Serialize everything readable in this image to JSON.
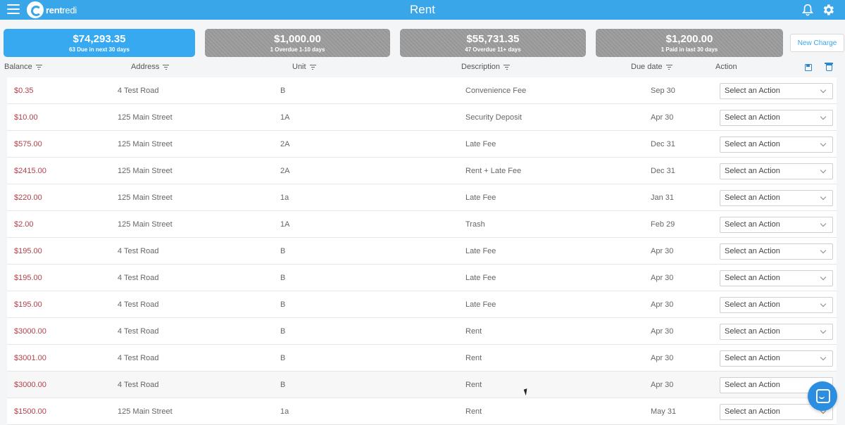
{
  "app": {
    "logo_bold": "rent",
    "logo_light": "redi",
    "title": "Rent"
  },
  "colors": {
    "accent": "#3aa6ea",
    "balance": "#b0414b",
    "card_inactive": "#9b9b9b"
  },
  "icons": {
    "menu": "hamburger-icon",
    "bell": "bell-icon",
    "settings": "gear-icon"
  },
  "cards": [
    {
      "amount": "$74,293.35",
      "label": "63 Due in next 30 days",
      "active": true
    },
    {
      "amount": "$1,000.00",
      "label": "1 Overdue 1-10 days",
      "active": false
    },
    {
      "amount": "$55,731.35",
      "label": "47 Overdue 11+ days",
      "active": false
    },
    {
      "amount": "$1,200.00",
      "label": "1 Paid in last 30 days",
      "active": false
    }
  ],
  "new_charge_label": "New Charge",
  "columns": {
    "balance": "Balance",
    "address": "Address",
    "unit": "Unit",
    "description": "Description",
    "due_date": "Due date",
    "action": "Action"
  },
  "rows": [
    {
      "balance": "$0.35",
      "address": "4 Test Road",
      "unit": "B",
      "description": "Convenience Fee",
      "due": "Sep 30",
      "action": "Select an Action"
    },
    {
      "balance": "$10.00",
      "address": "125 Main Street",
      "unit": "1A",
      "description": "Security Deposit",
      "due": "Apr 30",
      "action": "Select an Action"
    },
    {
      "balance": "$575.00",
      "address": "125 Main Street",
      "unit": "2A",
      "description": "Late Fee",
      "due": "Dec 31",
      "action": "Select an Action"
    },
    {
      "balance": "$2415.00",
      "address": "125 Main Street",
      "unit": "2A",
      "description": "Rent + Late Fee",
      "due": "Dec 31",
      "action": "Select an Action"
    },
    {
      "balance": "$220.00",
      "address": "125 Main Street",
      "unit": "1a",
      "description": "Late Fee",
      "due": "Jan 31",
      "action": "Select an Action"
    },
    {
      "balance": "$2.00",
      "address": "125 Main Street",
      "unit": "1A",
      "description": "Trash",
      "due": "Feb 29",
      "action": "Select an Action"
    },
    {
      "balance": "$195.00",
      "address": "4 Test Road",
      "unit": "B",
      "description": "Late Fee",
      "due": "Apr 30",
      "action": "Select an Action"
    },
    {
      "balance": "$195.00",
      "address": "4 Test Road",
      "unit": "B",
      "description": "Late Fee",
      "due": "Apr 30",
      "action": "Select an Action"
    },
    {
      "balance": "$195.00",
      "address": "4 Test Road",
      "unit": "B",
      "description": "Late Fee",
      "due": "Apr 30",
      "action": "Select an Action"
    },
    {
      "balance": "$3000.00",
      "address": "4 Test Road",
      "unit": "B",
      "description": "Rent",
      "due": "Apr 30",
      "action": "Select an Action"
    },
    {
      "balance": "$3001.00",
      "address": "4 Test Road",
      "unit": "B",
      "description": "Rent",
      "due": "Apr 30",
      "action": "Select an Action"
    },
    {
      "balance": "$3000.00",
      "address": "4 Test Road",
      "unit": "B",
      "description": "Rent",
      "due": "Apr 30",
      "action": "Select an Action"
    },
    {
      "balance": "$1500.00",
      "address": "125 Main Street",
      "unit": "1a",
      "description": "Rent",
      "due": "May 31",
      "action": "Select an Action"
    }
  ]
}
